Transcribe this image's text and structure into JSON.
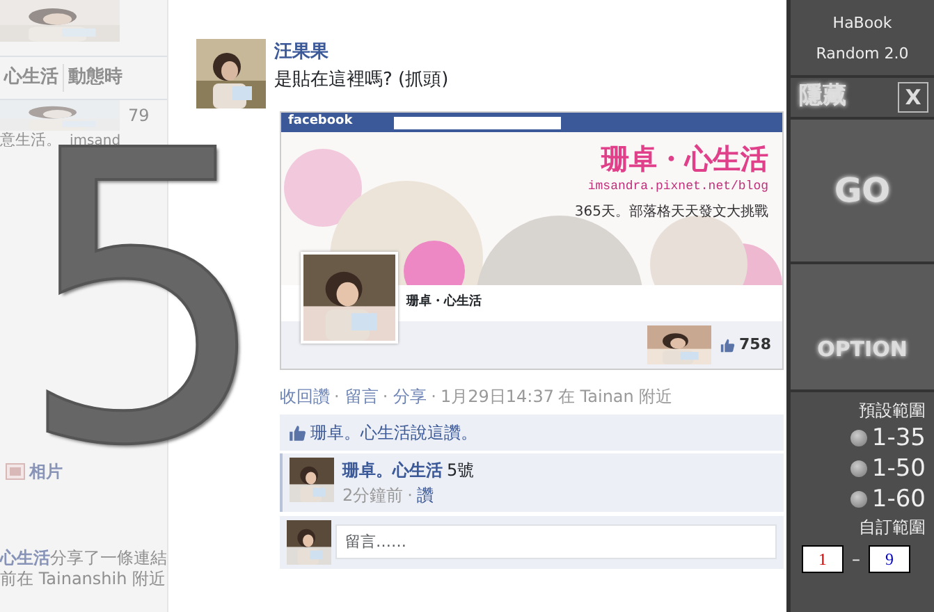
{
  "background_page": {
    "tabs": [
      "心生活",
      "動態時"
    ],
    "count": "79",
    "post_text": "意生活。",
    "link_text": "imsand",
    "photos_button": "相片",
    "share_author": "心生活",
    "share_text": "分享了一條連結",
    "share_place": "前在 Tainanshih 附近"
  },
  "overlay_number": "5",
  "post": {
    "author": "汪果果",
    "text": "是貼在這裡嗎? (抓頭)",
    "shared_screenshot": {
      "logo": "facebook",
      "cover_title": "珊卓・心生活",
      "cover_url": "imsandra.pixnet.net/blog",
      "cover_slogan": "365天。部落格天天發文大挑戰",
      "page_name": "珊卓・心生活",
      "like_count": "758"
    },
    "actions": [
      "收回讚",
      "留言",
      "分享"
    ],
    "separator": "·",
    "time": "1月29日14:37",
    "place": "在 Tainan 附近",
    "likes_text": "珊卓。心生活說這讚。",
    "comments": [
      {
        "author": "珊卓。心生活",
        "text": "5號",
        "time": "2分鐘前",
        "like": "讚"
      }
    ],
    "comment_placeholder": "留言……"
  },
  "app_panel": {
    "title": "HaBook",
    "subtitle": "Random 2.0",
    "hide_button": "隱藏",
    "close_button": "X",
    "go_button": "GO",
    "option_button": "OPTION",
    "preset_label": "預設範圍",
    "presets": [
      {
        "label": "1-35",
        "selected": false
      },
      {
        "label": "1-50",
        "selected": false
      },
      {
        "label": "1-60",
        "selected": false
      }
    ],
    "custom_label": "自訂範圍",
    "range_from": "1",
    "range_separator": "–",
    "range_to": "9"
  }
}
